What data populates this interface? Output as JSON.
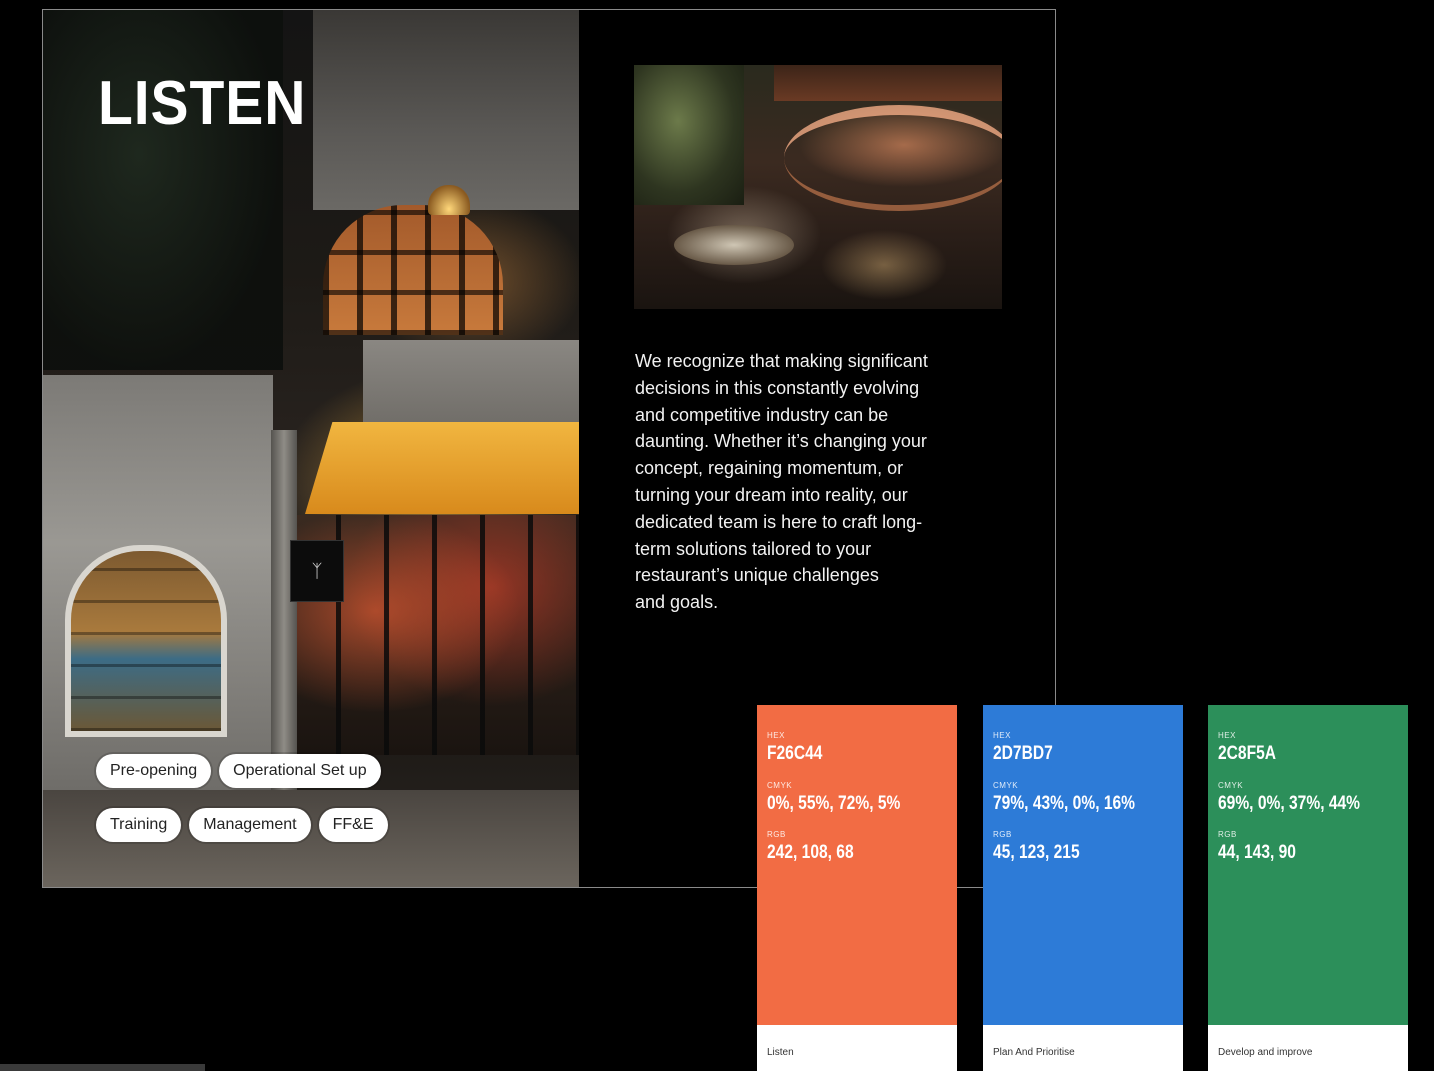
{
  "slide": {
    "title": "LISTEN",
    "tags_row1": [
      "Pre-opening",
      "Operational Set up"
    ],
    "tags_row2": [
      "Training",
      "Management",
      "FF&E"
    ],
    "description": "We recognize that making significant\ndecisions in this constantly evolving\nand competitive industry can be\ndaunting. Whether it’s changing your\nconcept, regaining momentum, or\nturning your dream into reality, our\ndedicated team is here to craft long-\nterm solutions tailored to your\nrestaurant’s unique challenges\nand goals.",
    "hero_sign": "ᛉ"
  },
  "swatches": [
    {
      "color": "#F26C44",
      "hex_label": "HEX",
      "hex": "F26C44",
      "cmyk_label": "CMYK",
      "cmyk": "0%, 55%, 72%, 5%",
      "rgb_label": "RGB",
      "rgb": "242, 108, 68",
      "name": "Listen"
    },
    {
      "color": "#2D7BD7",
      "hex_label": "HEX",
      "hex": "2D7BD7",
      "cmyk_label": "CMYK",
      "cmyk": "79%, 43%, 0%, 16%",
      "rgb_label": "RGB",
      "rgb": "45, 123, 215",
      "name": "Plan And Prioritise"
    },
    {
      "color": "#2C8F5A",
      "hex_label": "HEX",
      "hex": "2C8F5A",
      "cmyk_label": "CMYK",
      "cmyk": "69%, 0%, 37%, 44%",
      "rgb_label": "RGB",
      "rgb": "44, 143, 90",
      "name": "Develop and improve"
    }
  ]
}
